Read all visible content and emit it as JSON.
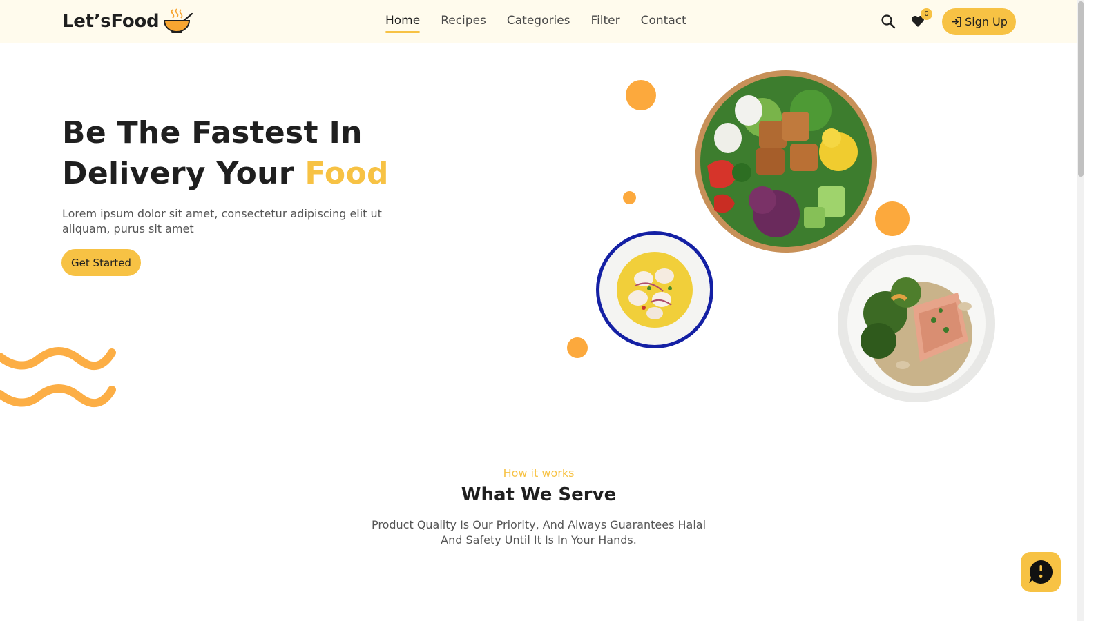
{
  "brand": {
    "name": "Let’sFood",
    "icon": "soup-bowl-icon"
  },
  "nav": {
    "links": [
      {
        "label": "Home",
        "active": true
      },
      {
        "label": "Recipes",
        "active": false
      },
      {
        "label": "Categories",
        "active": false
      },
      {
        "label": "Filter",
        "active": false
      },
      {
        "label": "Contact",
        "active": false
      }
    ],
    "search_icon": "search-icon",
    "favorites_icon": "heart-icon",
    "favorites_count": "0",
    "signup_label": "Sign Up",
    "signup_icon": "login-arrow-icon"
  },
  "hero": {
    "title_line1": "Be The Fastest In",
    "title_line2_prefix": "Delivery Your ",
    "title_accent": "Food",
    "description": "Lorem ipsum dolor sit amet, consectetur adipiscing elit ut aliquam, purus sit amet",
    "cta_label": "Get Started"
  },
  "section": {
    "eyebrow": "How it works",
    "title": "What We Serve",
    "description": "Product Quality Is Our Priority, And Always Guarantees Halal And Safety Until It Is In Your Hands."
  },
  "chat": {
    "icon": "chat-bubble-icon"
  },
  "colors": {
    "accent": "#f7c244",
    "orange": "#fca93d",
    "nav_bg": "#fffbed",
    "text": "#1f1f1f"
  }
}
